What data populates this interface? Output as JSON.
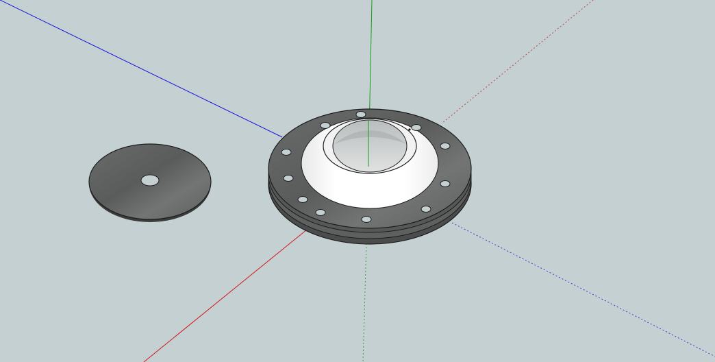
{
  "app": {
    "view": "3d-modeling-viewport",
    "colors": {
      "background": "#c5d0d2",
      "axis_red": "#d01818",
      "axis_green": "#12a012",
      "axis_blue": "#1414d8",
      "steel_dark": "#5d5f60",
      "steel_mid": "#6c6e6f",
      "steel_light": "#7d807f",
      "white_face": "#f7f7f7",
      "edge": "#1c1c1c"
    },
    "objects": [
      {
        "name": "flat-washer-disk",
        "icon": "disk-shape",
        "bolt_holes": 0,
        "center_hole": true
      },
      {
        "name": "weld-neck-flange",
        "icon": "flange-shape",
        "bolt_holes": 12,
        "center_hole": true
      }
    ]
  }
}
